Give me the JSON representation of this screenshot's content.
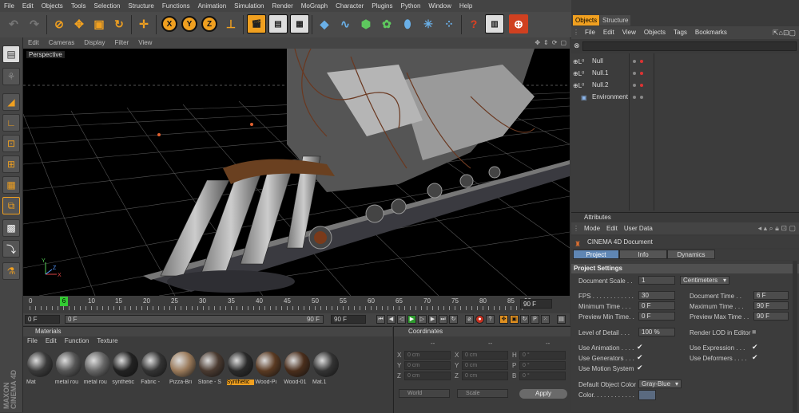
{
  "menubar": [
    "File",
    "Edit",
    "Objects",
    "Tools",
    "Selection",
    "Structure",
    "Functions",
    "Animation",
    "Simulation",
    "Render",
    "MoGraph",
    "Character",
    "Plugins",
    "Python",
    "Window",
    "Help"
  ],
  "toolbar": {
    "undo": "undo-icon",
    "redo": "redo-icon",
    "axis_x": "X",
    "axis_y": "Y",
    "axis_z": "Z"
  },
  "viewport": {
    "menu": [
      "Edit",
      "Cameras",
      "Display",
      "Filter",
      "View"
    ],
    "label": "Perspective"
  },
  "timeline": {
    "ticks": [
      "0",
      "5",
      "10",
      "15",
      "20",
      "25",
      "30",
      "35",
      "40",
      "45",
      "50",
      "55",
      "60",
      "65",
      "70",
      "75",
      "80",
      "85",
      "90"
    ],
    "current_frame": "6",
    "end_field": "90 F"
  },
  "playbar": {
    "start": "0 F",
    "slider_start": "0 F",
    "slider_end": "90 F",
    "end": "90 F"
  },
  "materials": {
    "title": "Materials",
    "menu": [
      "File",
      "Edit",
      "Function",
      "Texture"
    ],
    "items": [
      {
        "name": "Mat",
        "color": "#3a3a3a"
      },
      {
        "name": "metal rou",
        "color": "#555"
      },
      {
        "name": "metal rou",
        "color": "#666"
      },
      {
        "name": "synthetic",
        "color": "#222"
      },
      {
        "name": "Fabric -",
        "color": "#333"
      },
      {
        "name": "Pizza-Bri",
        "color": "#9a7a5a"
      },
      {
        "name": "Stone - S",
        "color": "#4a3a30"
      },
      {
        "name": "Synthetic",
        "color": "#2a2a2a",
        "selected": true
      },
      {
        "name": "Wood-Pi",
        "color": "#5a3a22"
      },
      {
        "name": "Wood-01",
        "color": "#4a2e1c"
      },
      {
        "name": "Mat.1",
        "color": "#333"
      }
    ]
  },
  "coordinates": {
    "title": "Coordinates",
    "col_heads": [
      "--",
      "--",
      "--"
    ],
    "rows": [
      {
        "a": "X",
        "av": "0 cm",
        "b": "X",
        "bv": "0 cm",
        "c": "H",
        "cv": "0 °"
      },
      {
        "a": "Y",
        "av": "0 cm",
        "b": "Y",
        "bv": "0 cm",
        "c": "P",
        "cv": "0 °"
      },
      {
        "a": "Z",
        "av": "0 cm",
        "b": "Z",
        "bv": "0 cm",
        "c": "B",
        "cv": "0 °"
      }
    ],
    "mode1": "World",
    "mode2": "Scale",
    "apply": "Apply"
  },
  "objects": {
    "tabs": [
      "Objects",
      "Structure"
    ],
    "menu": [
      "File",
      "Edit",
      "View",
      "Objects",
      "Tags",
      "Bookmarks"
    ],
    "items": [
      "Null",
      "Null.1",
      "Null.2",
      "Environment"
    ]
  },
  "attributes": {
    "title": "Attributes",
    "menu": [
      "Mode",
      "Edit",
      "User Data"
    ],
    "doc": "CINEMA 4D Document",
    "tabs": [
      "Project Settings",
      "Info",
      "Dynamics"
    ],
    "section": "Project Settings",
    "scale_label": "Document Scale . .",
    "scale_value": "1",
    "scale_unit": "Centimeters",
    "fps_label": "FPS . . . . . . . . . . . .",
    "fps": "30",
    "doctime_label": "Document Time . .",
    "doctime": "6 F",
    "mintime_label": "Minimum Time . . .",
    "mintime": "0 F",
    "maxtime_label": "Maximum Time . . .",
    "maxtime": "90 F",
    "prevmin_label": "Preview Min Time. .",
    "prevmin": "0 F",
    "prevmax_label": "Preview Max Time . .",
    "prevmax": "90 F",
    "lod_label": "Level of Detail . . .",
    "lod": "100 %",
    "renderlod_label": "Render LOD in Editor",
    "useanim": "Use Animation . . . .",
    "usegen": "Use Generators . . .",
    "usemotion": "Use Motion System",
    "useexpr": "Use Expression . . .",
    "usedef": "Use Deformers . . . .",
    "defcolor_label": "Default Object Color",
    "defcolor": "Gray-Blue",
    "color_label": "Color. . . . . . . . . . . ."
  },
  "maxon": {
    "line1": "MAXON",
    "line2": "CINEMA 4D"
  }
}
